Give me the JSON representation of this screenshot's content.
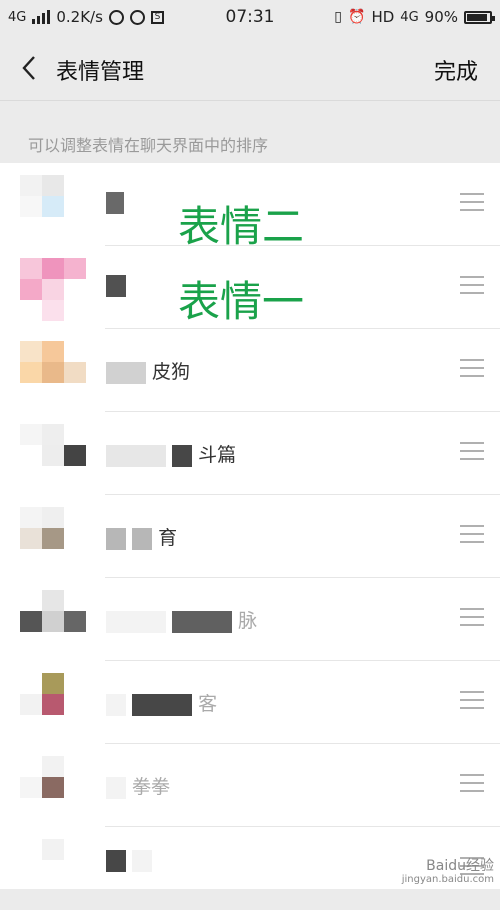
{
  "status": {
    "network": "4G",
    "speed": "0.2K/s",
    "time": "07:31",
    "hd": "HD",
    "net_right": "4G",
    "battery": "90%",
    "battery_level": 0.9
  },
  "nav": {
    "title": "表情管理",
    "done_label": "完成"
  },
  "hint": "可以调整表情在聊天界面中的排序",
  "items": [
    {
      "name": "",
      "annotation": "表情二"
    },
    {
      "name": "",
      "annotation": "表情一"
    },
    {
      "name": "皮狗"
    },
    {
      "name": "斗篇"
    },
    {
      "name": "育"
    },
    {
      "name": "脉"
    },
    {
      "name": "客"
    },
    {
      "name": "拳拳"
    },
    {
      "name": ""
    }
  ],
  "watermark": {
    "line1": "Baidu经验",
    "line2": "jingyan.baidu.com"
  },
  "colors": {
    "annotation": "#1aa24a",
    "accent": "#1aa24a"
  }
}
